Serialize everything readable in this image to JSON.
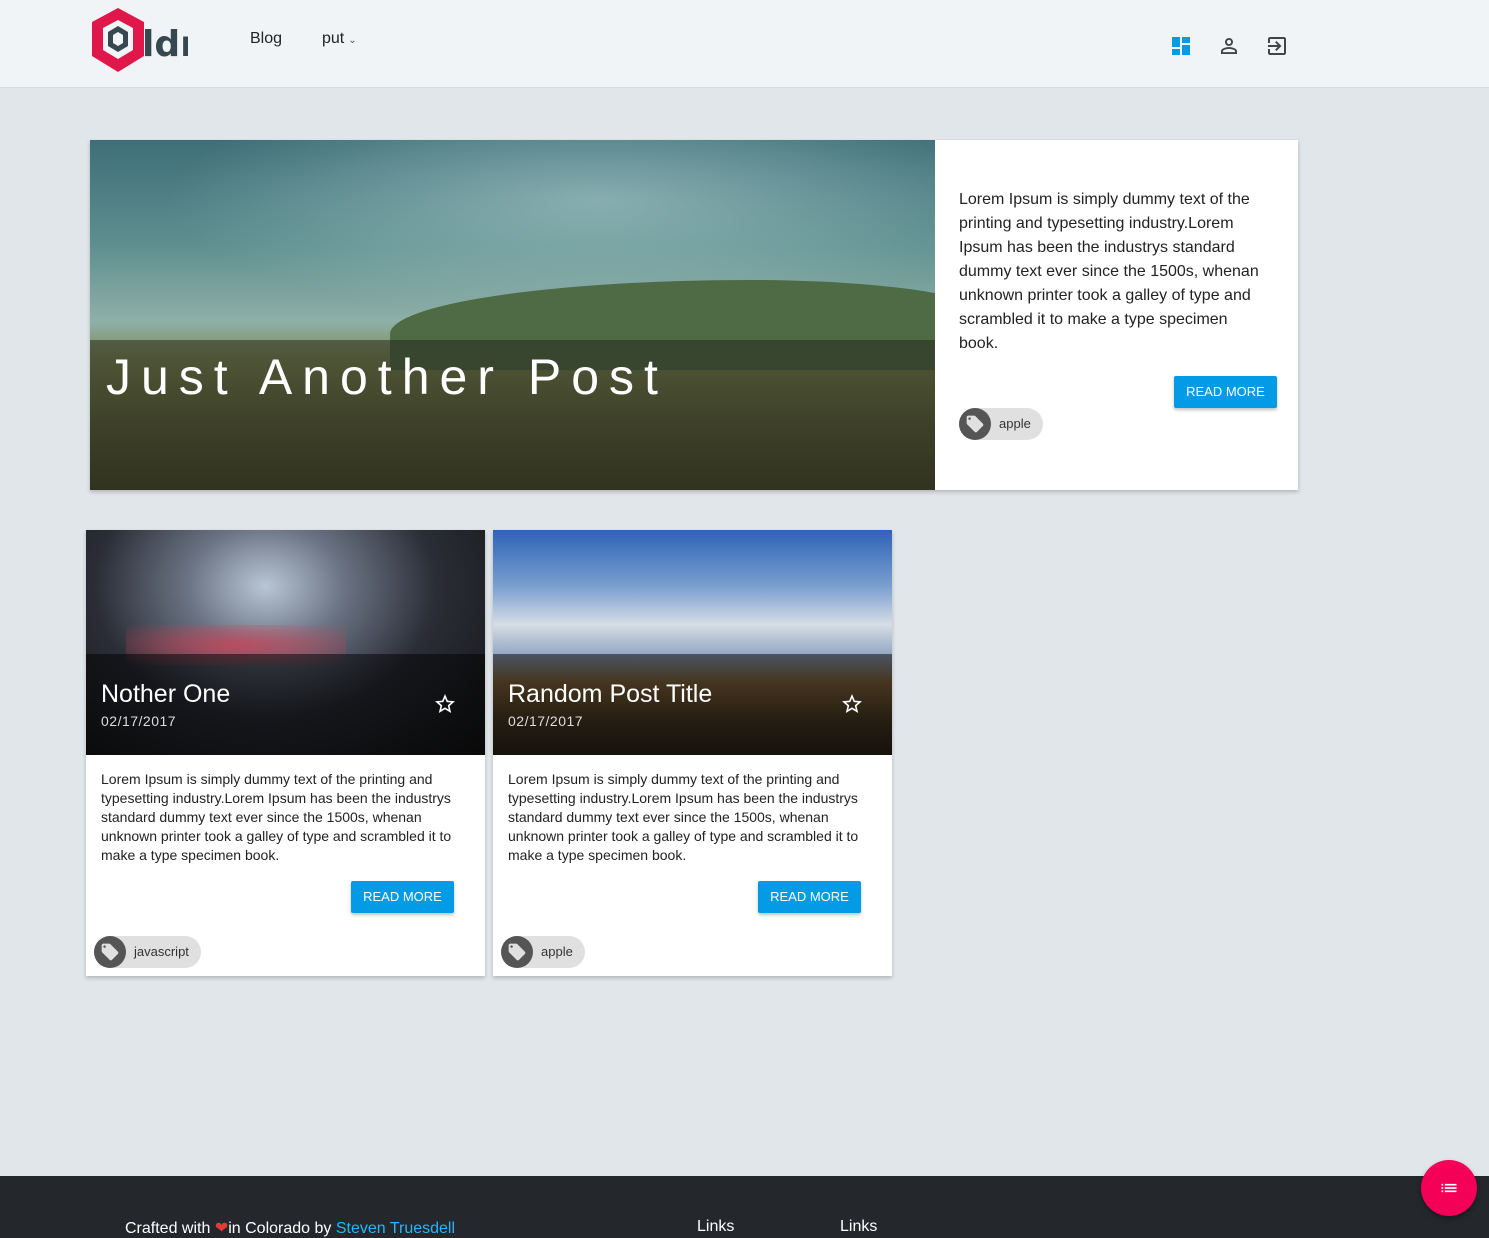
{
  "header": {
    "logo_text": "ldr",
    "nav": {
      "blog": "Blog",
      "put": "put"
    },
    "icons": [
      "dashboard-icon",
      "account-icon",
      "exit-icon"
    ]
  },
  "featured": {
    "title": "Just Another Post",
    "excerpt": "Lorem Ipsum is simply dummy text of the printing and typesetting industry.Lorem Ipsum has been the industrys standard dummy text ever since the 1500s, whenan unknown printer took a galley of type and scrambled it to make a type specimen book.",
    "button": "READ MORE",
    "tag": "apple"
  },
  "cards": [
    {
      "title": "Nother One",
      "date": "02/17/2017",
      "excerpt": "Lorem Ipsum is simply dummy text of the printing and typesetting industry.Lorem Ipsum has been the industrys standard dummy text ever since the 1500s, whenan unknown printer took a galley of type and scrambled it to make a type specimen book.",
      "button": "READ MORE",
      "tag": "javascript"
    },
    {
      "title": "Random Post Title",
      "date": "02/17/2017",
      "excerpt": "Lorem Ipsum is simply dummy text of the printing and typesetting industry.Lorem Ipsum has been the industrys standard dummy text ever since the 1500s, whenan unknown printer took a galley of type and scrambled it to make a type specimen book.",
      "button": "READ MORE",
      "tag": "apple"
    }
  ],
  "footer": {
    "credit_prefix": "Crafted with ",
    "credit_middle": "in Colorado by ",
    "author": "Steven Truesdell",
    "links_1": "Links",
    "links_2": "Links"
  },
  "colors": {
    "accent": "#039be5",
    "fab": "#f50057",
    "logo": "#e0174a",
    "footer_bg": "#24272c"
  }
}
